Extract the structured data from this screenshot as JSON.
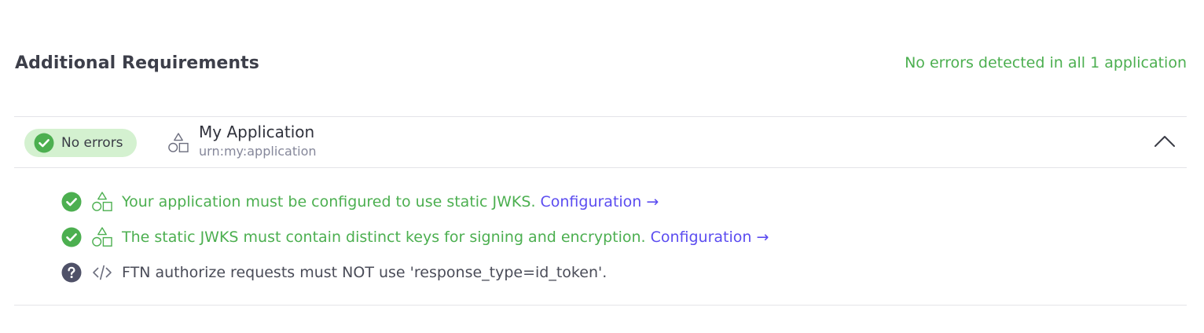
{
  "section": {
    "title": "Additional Requirements",
    "summary": "No errors detected in all 1 application"
  },
  "application": {
    "status_label": "No errors",
    "status_icon": "check-circle-icon",
    "type_icon": "shapes-icon",
    "name": "My Application",
    "urn": "urn:my:application",
    "collapse_icon": "chevron-up-icon"
  },
  "requirements": [
    {
      "status": "passed",
      "status_icon": "check-circle-icon",
      "type_icon": "shapes-icon",
      "text": "Your application must be configured to use static JWKS.",
      "link_label": "Configuration →"
    },
    {
      "status": "passed",
      "status_icon": "check-circle-icon",
      "type_icon": "shapes-icon",
      "text": "The static JWKS must contain distinct keys for signing and encryption.",
      "link_label": "Configuration →"
    },
    {
      "status": "unknown",
      "status_icon": "question-circle-icon",
      "type_icon": "code-icon",
      "text": "FTN authorize requests must NOT use 'response_type=id_token'.",
      "link_label": ""
    }
  ],
  "colors": {
    "success": "#4caf50",
    "success_bg": "#d4f1d0",
    "link": "#5b4cf0",
    "unknown": "#4f5168",
    "text": "#3d3f4a"
  }
}
